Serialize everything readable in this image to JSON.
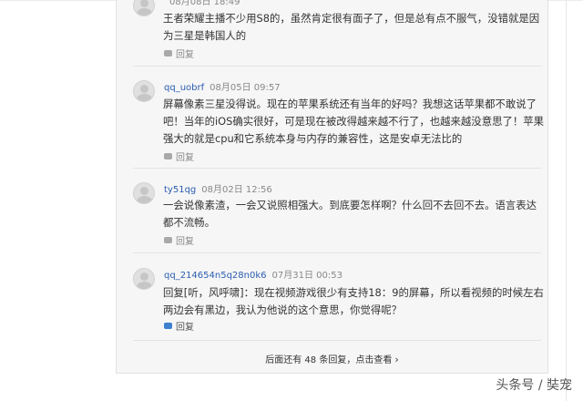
{
  "comments": [
    {
      "user": "",
      "date": "08月08日 18:49",
      "text": "王者荣耀主播不少用S8的，虽然肯定很有面子了，但是总有点不服气，没错就是因为三星是韩国人的",
      "reply": "回复"
    },
    {
      "user": "qq_uobrf",
      "date": "08月05日 09:57",
      "text": "屏幕像素三星没得说。现在的苹果系统还有当年的好吗？我想这话苹果都不敢说了吧！当年的iOS确实很好，可是现在被改得越来越不行了，也越来越没意思了！苹果强大的就是cpu和它系统本身与内存的兼容性，这是安卓无法比的",
      "reply": "回复"
    },
    {
      "user": "ty51qg",
      "date": "08月02日 12:56",
      "text": "一会说像素渣，一会又说照相强大。到底要怎样啊？什么回不去回不去。语言表达都不流畅。",
      "reply": "回复"
    },
    {
      "user": "qq_214654n5q28n0k6",
      "date": "07月31日 00:53",
      "text": "回复[听，风呼啸]：现在视频游戏很少有支持18：9的屏幕，所以看视频的时候左右两边会有黑边，我认为他说的这个意思，你觉得呢？",
      "reply": "回复"
    }
  ],
  "more_replies": "后面还有 48 条回复，点击查看",
  "watermark": "头条号 / 奘宠"
}
